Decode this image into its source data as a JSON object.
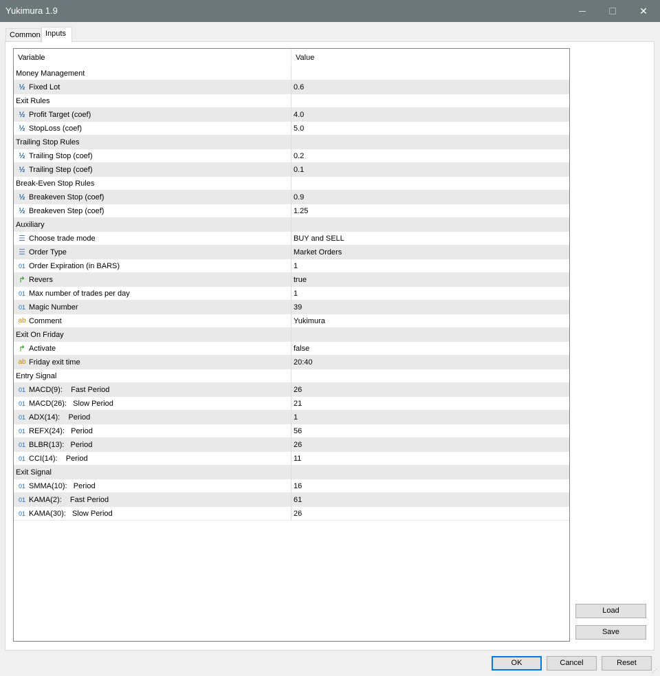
{
  "window": {
    "title": "Yukimura 1.9",
    "close_glyph": "✕"
  },
  "tabs": [
    {
      "label": "Common",
      "active": false
    },
    {
      "label": "Inputs",
      "active": true
    }
  ],
  "grid": {
    "col_variable": "Variable",
    "col_value": "Value",
    "rows": [
      {
        "type": "group",
        "variable": "Money Management",
        "value": ""
      },
      {
        "type": "param",
        "icon": "double",
        "variable": "Fixed Lot",
        "value": "0.6"
      },
      {
        "type": "group",
        "variable": "Exit Rules",
        "value": ""
      },
      {
        "type": "param",
        "icon": "double",
        "variable": "Profit Target (coef)",
        "value": "4.0"
      },
      {
        "type": "param",
        "icon": "double",
        "variable": "StopLoss (coef)",
        "value": "5.0"
      },
      {
        "type": "group",
        "variable": "Trailing Stop Rules",
        "value": ""
      },
      {
        "type": "param",
        "icon": "double",
        "variable": "Trailing Stop (coef)",
        "value": "0.2"
      },
      {
        "type": "param",
        "icon": "double",
        "variable": "Trailing Step (coef)",
        "value": "0.1"
      },
      {
        "type": "group",
        "variable": "Break-Even Stop Rules",
        "value": ""
      },
      {
        "type": "param",
        "icon": "double",
        "variable": "Breakeven Stop (coef)",
        "value": "0.9"
      },
      {
        "type": "param",
        "icon": "double",
        "variable": "Breakeven Step (coef)",
        "value": "1.25"
      },
      {
        "type": "group",
        "variable": "Auxiliary",
        "value": ""
      },
      {
        "type": "param",
        "icon": "enum",
        "variable": "Choose trade mode",
        "value": "BUY and SELL"
      },
      {
        "type": "param",
        "icon": "enum",
        "variable": "Order Type",
        "value": "Market Orders"
      },
      {
        "type": "param",
        "icon": "int",
        "variable": "Order Expiration (in BARS)",
        "value": "1"
      },
      {
        "type": "param",
        "icon": "bool",
        "variable": "Revers",
        "value": "true"
      },
      {
        "type": "param",
        "icon": "int",
        "variable": "Max number of trades per day",
        "value": "1"
      },
      {
        "type": "param",
        "icon": "int",
        "variable": "Magic Number",
        "value": "39"
      },
      {
        "type": "param",
        "icon": "string",
        "variable": "Comment",
        "value": "Yukimura"
      },
      {
        "type": "group",
        "variable": "Exit On Friday",
        "value": ""
      },
      {
        "type": "param",
        "icon": "bool",
        "variable": "Activate",
        "value": "false"
      },
      {
        "type": "param",
        "icon": "string",
        "variable": "Friday exit time",
        "value": "20:40"
      },
      {
        "type": "group",
        "variable": "Entry Signal",
        "value": ""
      },
      {
        "type": "param",
        "icon": "int",
        "variable": "MACD(9):    Fast Period",
        "value": "26"
      },
      {
        "type": "param",
        "icon": "int",
        "variable": "MACD(26):   Slow Period",
        "value": "21"
      },
      {
        "type": "param",
        "icon": "int",
        "variable": "ADX(14):    Period",
        "value": "1"
      },
      {
        "type": "param",
        "icon": "int",
        "variable": "REFX(24):   Period",
        "value": "56"
      },
      {
        "type": "param",
        "icon": "int",
        "variable": "BLBR(13):   Period",
        "value": "26"
      },
      {
        "type": "param",
        "icon": "int",
        "variable": "CCI(14):    Period",
        "value": "11"
      },
      {
        "type": "group",
        "variable": "Exit Signal",
        "value": ""
      },
      {
        "type": "param",
        "icon": "int",
        "variable": "SMMA(10):   Period",
        "value": "16"
      },
      {
        "type": "param",
        "icon": "int",
        "variable": "KAMA(2):    Fast Period",
        "value": "61"
      },
      {
        "type": "param",
        "icon": "int",
        "variable": "KAMA(30):   Slow Period",
        "value": "26"
      }
    ]
  },
  "icons": {
    "double": {
      "glyph": "½",
      "name": "double-type-icon"
    },
    "int": {
      "glyph": "01",
      "name": "integer-type-icon"
    },
    "enum": {
      "glyph": "☰",
      "name": "enum-type-icon"
    },
    "bool": {
      "glyph": "↱",
      "name": "boolean-type-icon"
    },
    "string": {
      "glyph": "ab",
      "name": "string-type-icon"
    }
  },
  "buttons": {
    "load": "Load",
    "save": "Save",
    "ok": "OK",
    "cancel": "Cancel",
    "reset": "Reset"
  },
  "colors": {
    "titlebar": "#6b7778",
    "row_shade": "#e9e9e9",
    "ok_focus": "#0078d7"
  }
}
